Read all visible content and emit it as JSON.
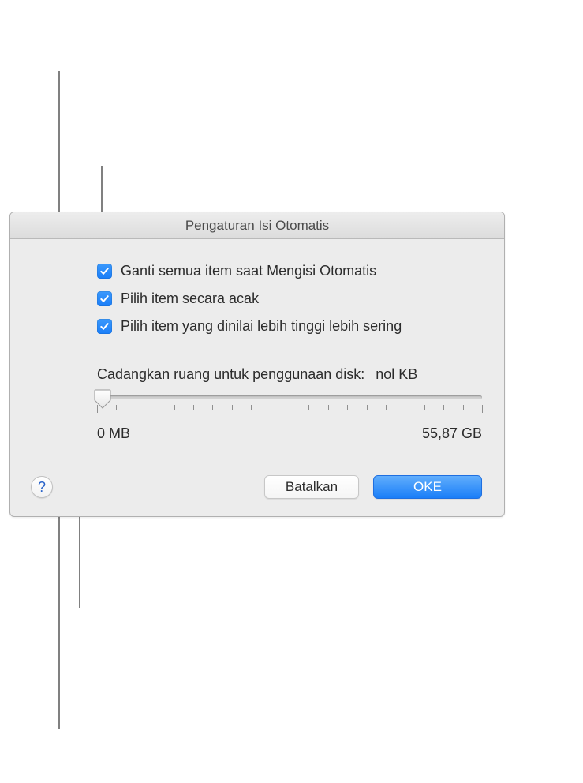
{
  "dialog": {
    "title": "Pengaturan Isi Otomatis",
    "checkboxes": [
      {
        "label": "Ganti semua item saat Mengisi Otomatis",
        "checked": true
      },
      {
        "label": "Pilih item secara acak",
        "checked": true
      },
      {
        "label": "Pilih item yang dinilai lebih tinggi lebih sering",
        "checked": true
      }
    ],
    "reserve": {
      "label": "Cadangkan ruang untuk penggunaan disk:",
      "value": "nol KB",
      "min_label": "0 MB",
      "max_label": "55,87 GB"
    },
    "buttons": {
      "help": "?",
      "cancel": "Batalkan",
      "ok": "OKE"
    }
  }
}
